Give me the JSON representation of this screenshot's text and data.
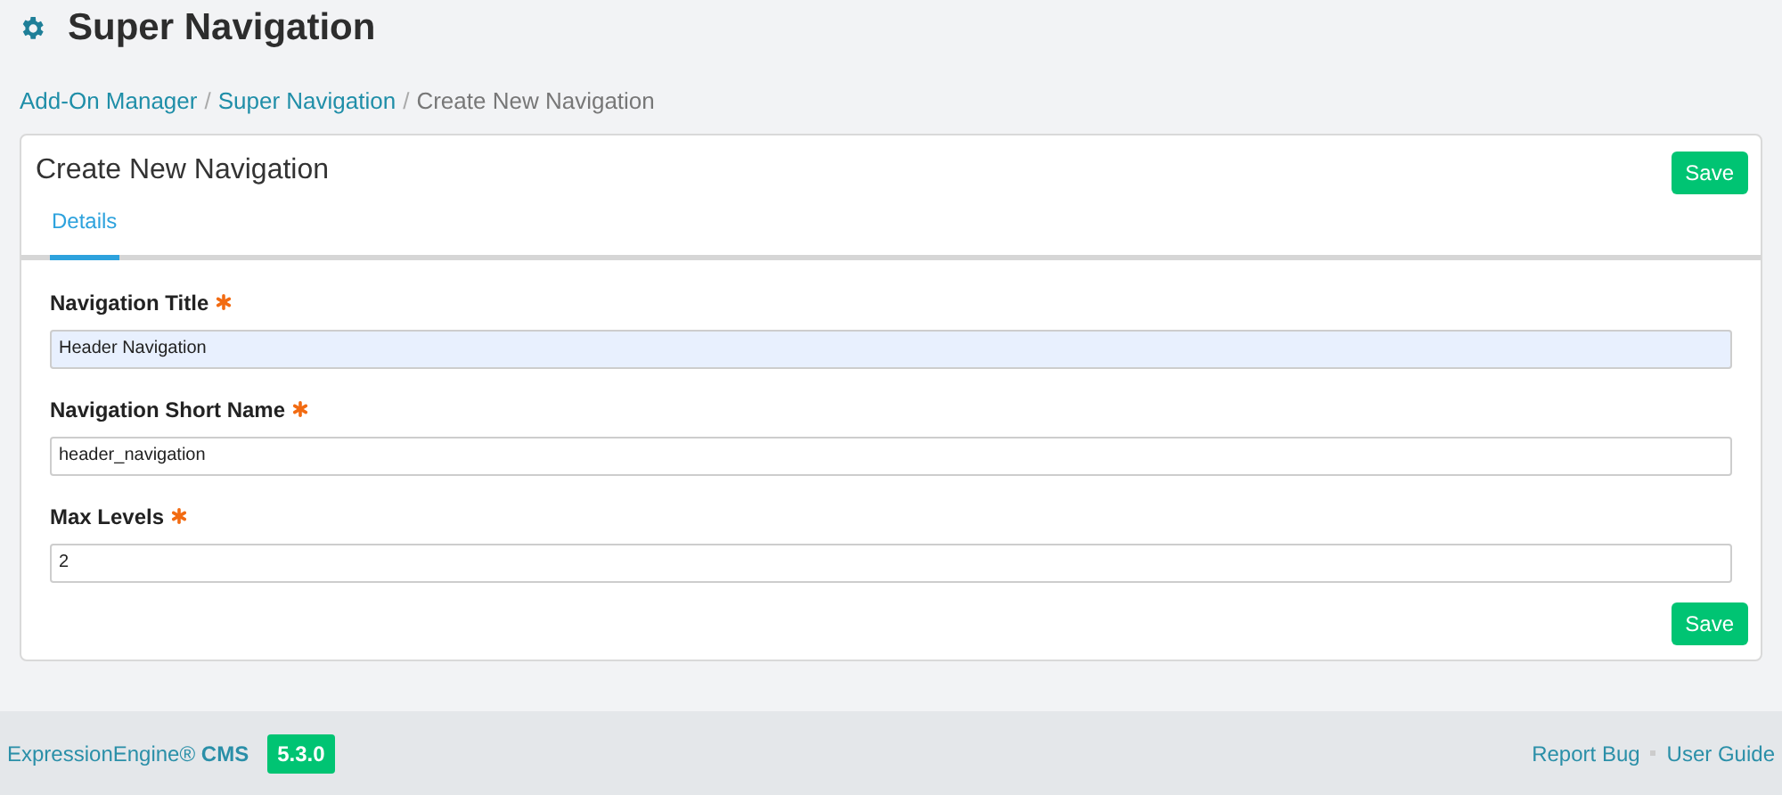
{
  "header": {
    "title": "Super Navigation"
  },
  "breadcrumb": [
    {
      "kind": "link",
      "label": "Add-On Manager"
    },
    {
      "kind": "separator",
      "label": "/"
    },
    {
      "kind": "link",
      "label": "Super Navigation"
    },
    {
      "kind": "separator",
      "label": "/"
    },
    {
      "kind": "current",
      "label": "Create New Navigation"
    }
  ],
  "card": {
    "title": "Create New Navigation",
    "top_button": "Save",
    "bottom_button": "Save",
    "tabs": [
      {
        "label": "Details",
        "selected": true
      }
    ],
    "fields": [
      {
        "label": "Navigation Title",
        "required": true,
        "value": "Header Navigation",
        "highlighted": true
      },
      {
        "label": "Navigation Short Name",
        "required": true,
        "value": "header_navigation",
        "highlighted": false
      },
      {
        "label": "Max Levels",
        "required": true,
        "value": "2",
        "highlighted": false
      }
    ]
  },
  "footer": {
    "product": "ExpressionEngine® **CMS**",
    "version": "5.3.0",
    "links": [
      "Report Bug",
      "User Guide"
    ]
  }
}
